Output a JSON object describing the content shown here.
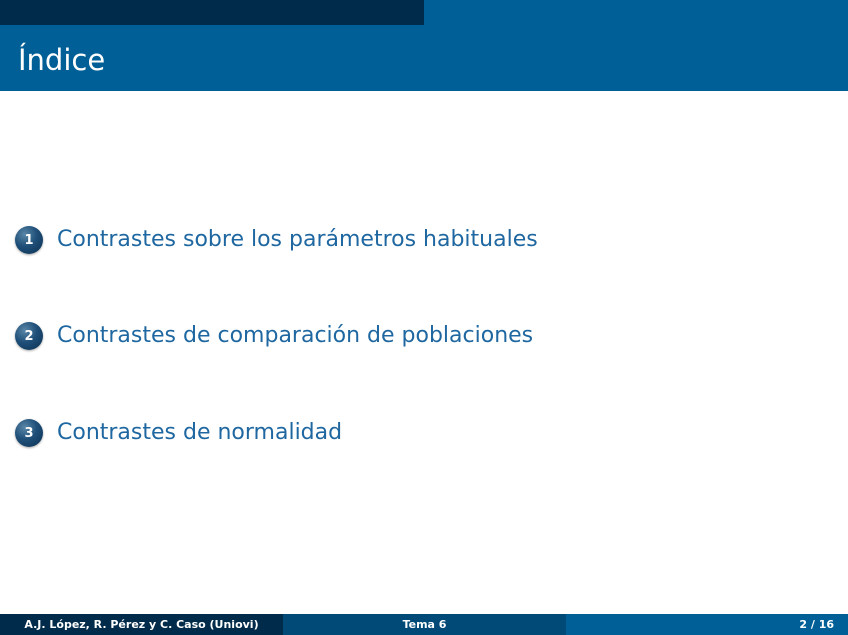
{
  "title": "Índice",
  "toc": [
    {
      "number": "1",
      "label": "Contrastes sobre los parámetros habituales"
    },
    {
      "number": "2",
      "label": "Contrastes de comparación de poblaciones"
    },
    {
      "number": "3",
      "label": "Contrastes de normalidad"
    }
  ],
  "footer": {
    "authors": "A.J. López, R. Pérez y C. Caso (Uniovi)",
    "topic": "Tema 6",
    "page": "2 / 16"
  },
  "colors": {
    "header_dark": "#002b4a",
    "header_blue": "#005f96",
    "link_blue": "#1f67a0",
    "footer_middle": "#014a78"
  }
}
